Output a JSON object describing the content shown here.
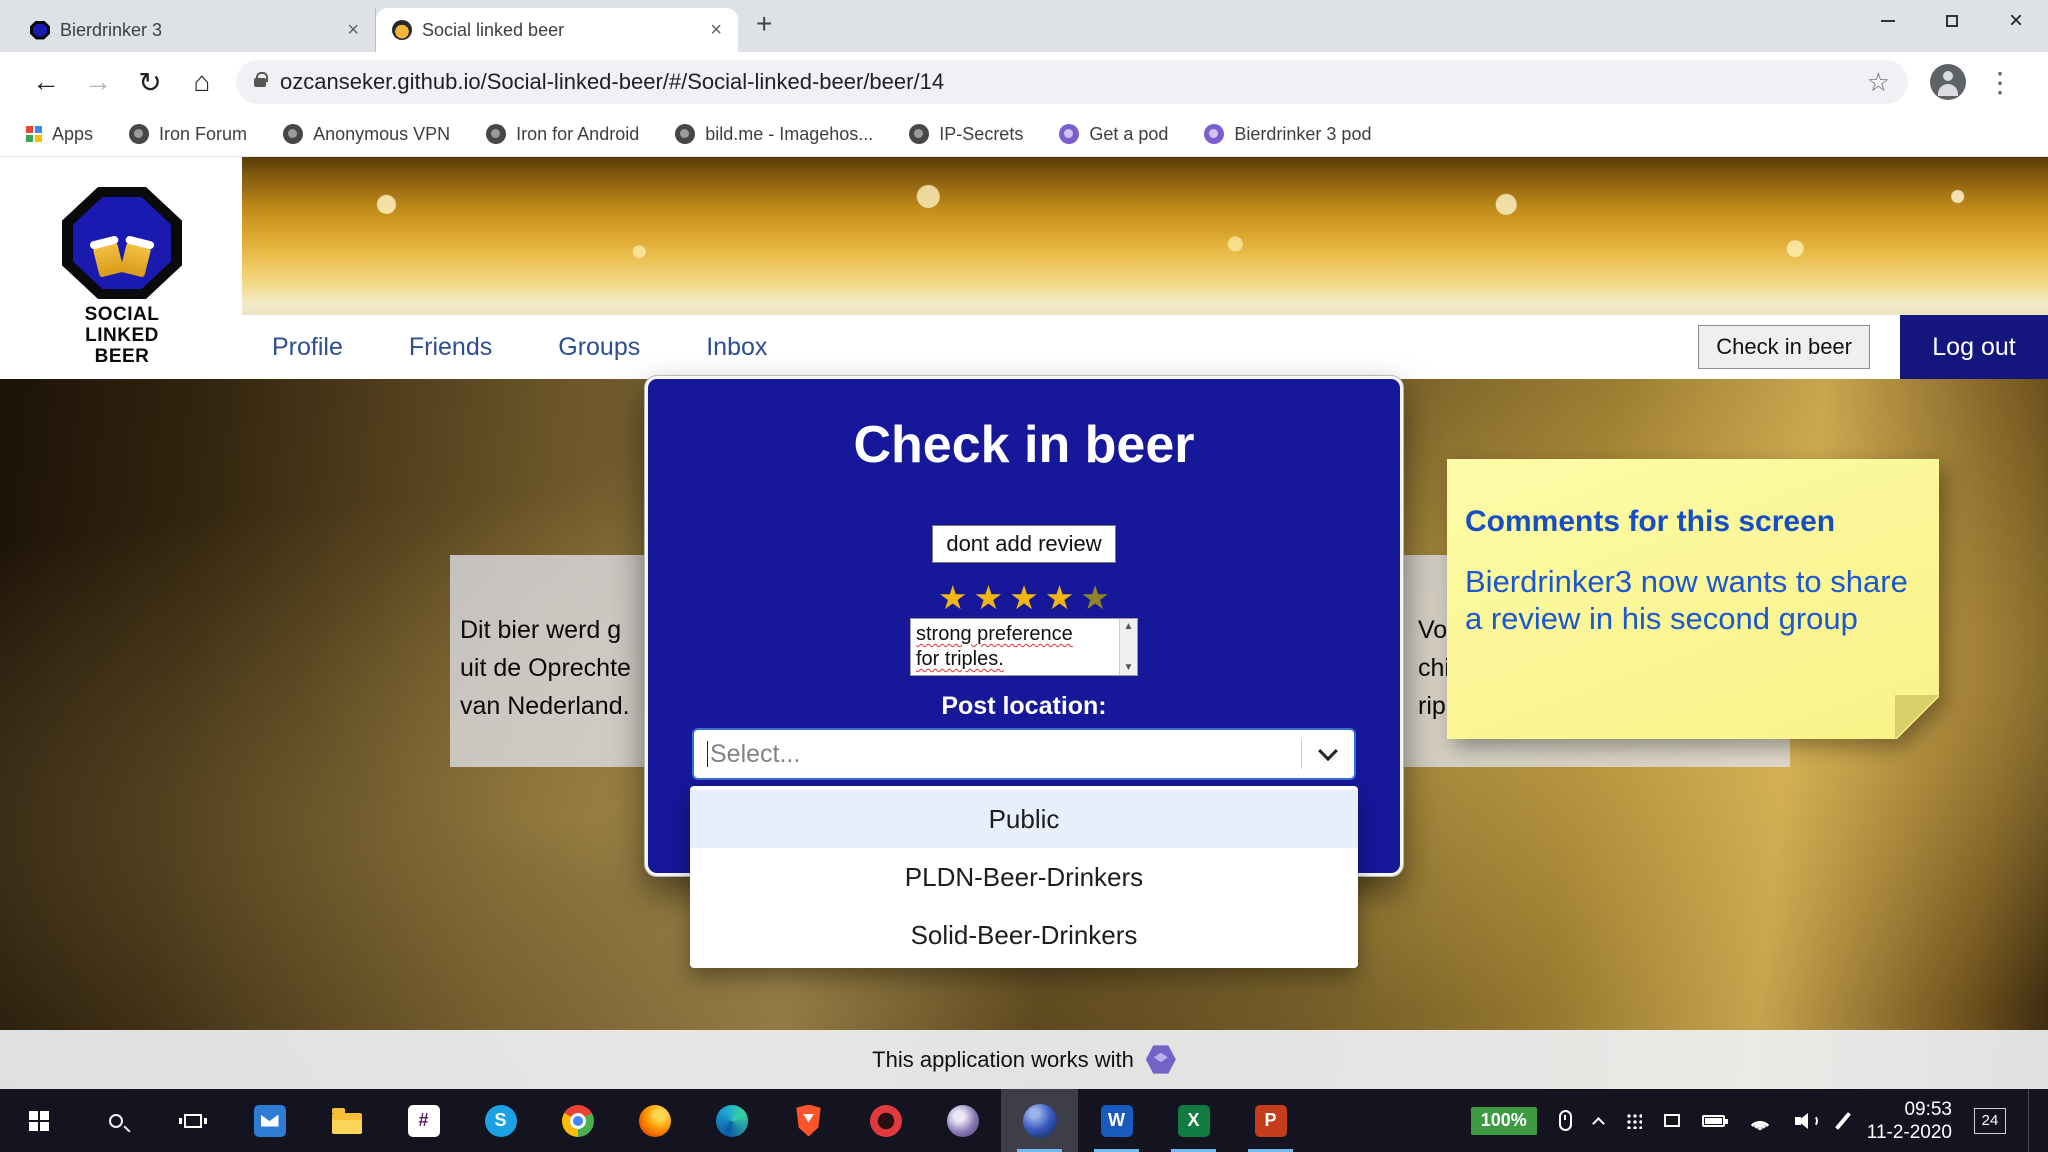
{
  "browser": {
    "tabs": [
      {
        "title": "Bierdrinker 3"
      },
      {
        "title": "Social linked beer"
      }
    ],
    "url": "ozcanseker.github.io/Social-linked-beer/#/Social-linked-beer/beer/14",
    "bookmarks": [
      "Apps",
      "Iron Forum",
      "Anonymous VPN",
      "Iron for Android",
      "bild.me - Imagehos...",
      "IP-Secrets",
      "Get a pod",
      "Bierdrinker 3 pod"
    ]
  },
  "site": {
    "logo_line1": "SOCIAL",
    "logo_line2": "LINKED BEER",
    "nav": [
      "Profile",
      "Friends",
      "Groups",
      "Inbox"
    ],
    "check_in_button": "Check in beer",
    "logout_button": "Log out",
    "left_text_lines": [
      "Dit bier werd g",
      "uit de Oprechte",
      "van Nederland."
    ],
    "right_text_lines": [
      "Vo",
      "chij",
      "ripl"
    ],
    "footer_text": "This application works with"
  },
  "modal": {
    "title": "Check in beer",
    "dont_add_review": "dont add review",
    "rating": 4,
    "rating_max": 5,
    "review_line1": "strong preference",
    "review_line2": "for triples.",
    "post_location_label": "Post location:",
    "select_placeholder": "Select...",
    "options": [
      "Public",
      "PLDN-Beer-Drinkers",
      "Solid-Beer-Drinkers"
    ]
  },
  "note": {
    "title": "Comments for this screen",
    "body": "Bierdrinker3 now wants to share a review in his second group"
  },
  "taskbar": {
    "battery_percent": "100%",
    "time": "09:53",
    "date": "11-2-2020",
    "notification_count": "24"
  },
  "colors": {
    "modal_bg": "#17179a",
    "site_accent_blue": "#15157e",
    "note_bg": "#fbf89c",
    "note_text": "#1b57d0",
    "star_filled": "#f2b611",
    "star_empty": "#8f8426",
    "option_highlight": "#e7effd"
  }
}
